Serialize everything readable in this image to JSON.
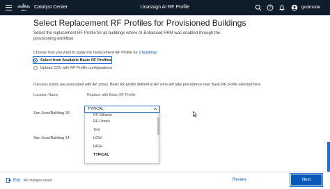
{
  "header": {
    "app_name": "Catalyst Center",
    "page_title": "Unassign AI RF Profile",
    "username": "godmode"
  },
  "main": {
    "title": "Select Replacement RF Profiles for Provisioned Buildings",
    "description": "Select the replacement RF Profile for all buildings where AI-Enhanced RRM was enabled through the provisioning workflow.",
    "choose_prefix": "Choose how you want to apply the replacement RF Profile for ",
    "choose_link": "2 buildings",
    "options": [
      {
        "label": "Select from Available Basic RF Profiles",
        "selected": true
      },
      {
        "label": "Upload CSV with RF Profile configurations",
        "selected": false
      }
    ],
    "note": "If access points are associated with AP zones, Basic RF profile defined in AP zone will take precedence over Basic RF profile selected here.",
    "columns": {
      "location": "Location Name",
      "replace": "Replace with Basic RF Profile"
    },
    "rows": [
      {
        "location": "San Jose/Building 18"
      },
      {
        "location": "San Jose/Building 14"
      }
    ],
    "select": {
      "value": "TYPICAL",
      "options": [
        "RF-Gillaroo",
        "RF-Omnis",
        "Test",
        "LOW",
        "HIGH",
        "TYPICAL"
      ]
    }
  },
  "footer": {
    "exit_label": "Exit",
    "saved_label": "All changes saved",
    "review_label": "Review",
    "next_label": "Next"
  },
  "colors": {
    "header_bg": "#0f1d2a",
    "primary": "#0a59b8",
    "focus": "#1d6fd6"
  }
}
